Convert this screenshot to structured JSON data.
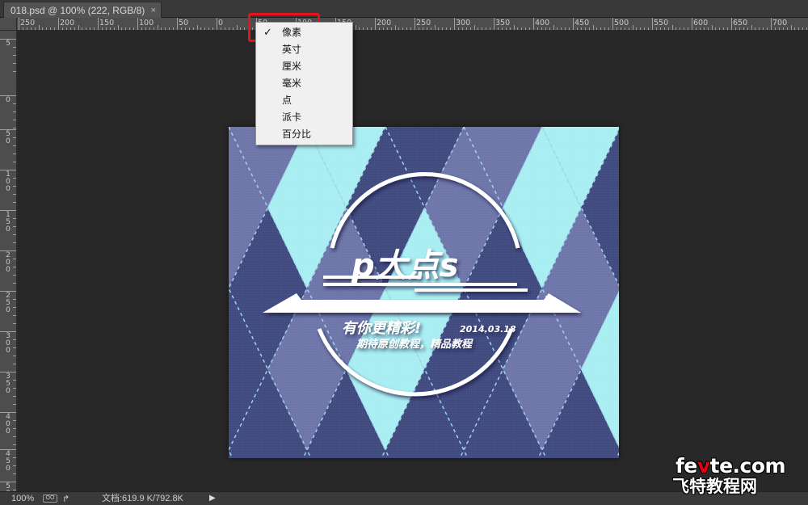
{
  "window": {
    "doc_tab_title": "018.psd @ 100% (222, RGB/8)",
    "close_glyph": "×"
  },
  "ruler": {
    "top_labels": [
      "250",
      "200",
      "150",
      "100",
      "50",
      "0",
      "50",
      "100",
      "150",
      "200",
      "250",
      "300",
      "350",
      "400",
      "450",
      "500",
      "550",
      "600",
      "650",
      "700"
    ],
    "left_labels": [
      "5",
      "0",
      "5 0",
      "1 0 0",
      "1 5 0",
      "2 0 0",
      "2 5 0",
      "3 0 0",
      "3 5 0",
      "4 0 0",
      "4 5 0",
      "5 0 0"
    ]
  },
  "units_menu": {
    "selected_check": "✓",
    "items": [
      "像素",
      "英寸",
      "厘米",
      "毫米",
      "点",
      "派卡",
      "百分比"
    ]
  },
  "artwork": {
    "title": "p大点s",
    "slogan": "有你更精彩!",
    "date": "2014.03.18",
    "subtitle": "期待原创教程，精品教程",
    "colors": {
      "navy": "#414b80",
      "mid_blue": "#6e76aa",
      "light_cyan": "#a9eef2",
      "stitch": "#9fd4e8"
    }
  },
  "statusbar": {
    "zoom": "100%",
    "icon1_label": "OO",
    "icon2_glyph": "↱",
    "doc_info": "文档:619.9 K/792.8K",
    "arrow_glyph": "▶"
  },
  "watermark": {
    "site_pre": "fe",
    "site_accent": "v",
    "site_post": "te.com",
    "site_cn": "飞特教程网"
  }
}
